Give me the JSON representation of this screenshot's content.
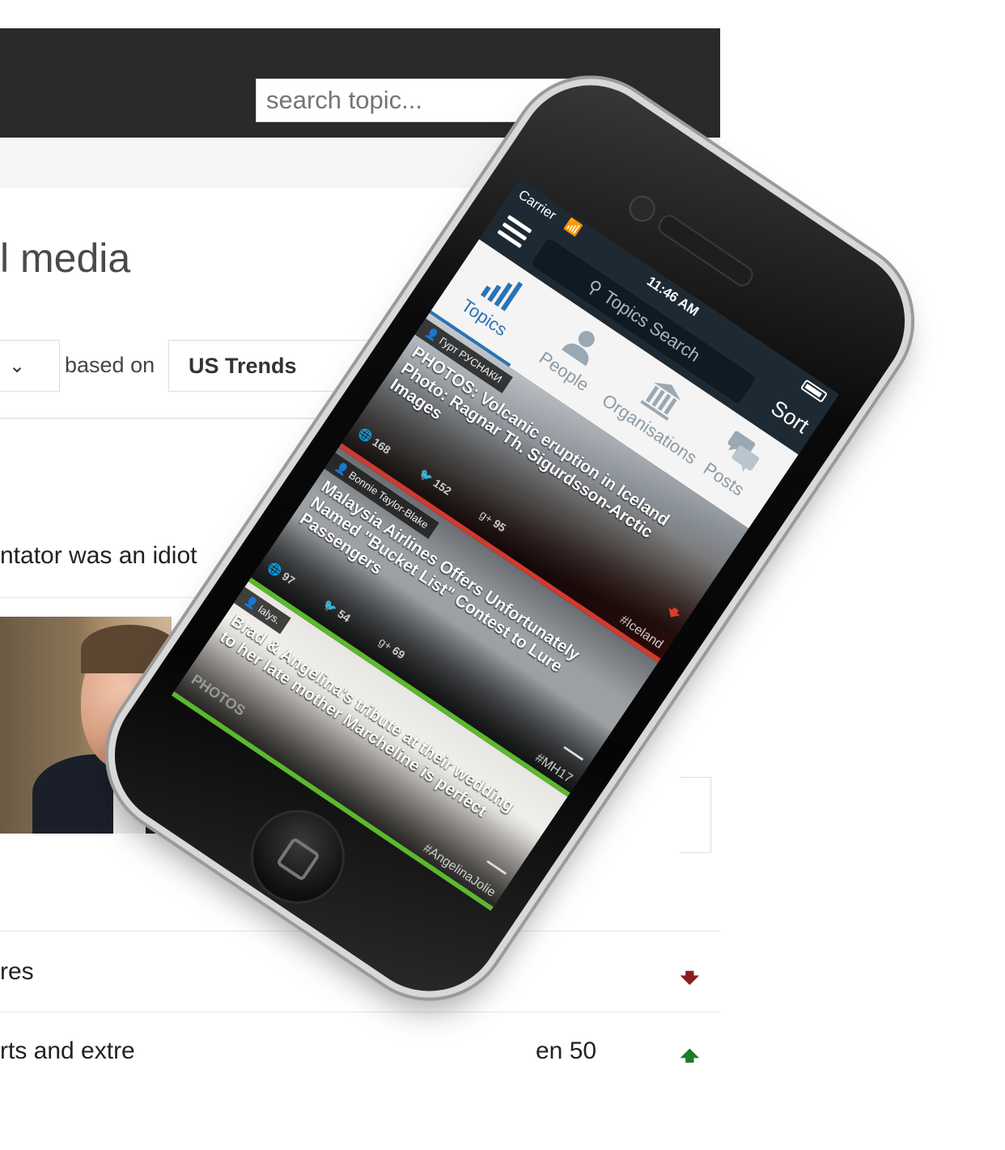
{
  "web": {
    "search_placeholder": "search topic...",
    "title_partial": "l media",
    "based_on": "based on",
    "trend_source": "US Trends",
    "headline_partial": "ntator was an idiot",
    "row1_partial": "res",
    "row2_partial": "rts and extre",
    "row2_tail": "en 50",
    "row1_trend": "down",
    "row2_trend": "up",
    "colors": {
      "topbar": "#2a2a2a",
      "down": "#8a1c1c",
      "up": "#1f7a2a"
    }
  },
  "phone": {
    "status": {
      "carrier": "Carrier",
      "time": "11:46 AM"
    },
    "nav": {
      "search_placeholder": "Topics Search",
      "sort_label": "Sort"
    },
    "tabs": [
      {
        "label": "Topics",
        "icon": "bar-chart-icon",
        "active": true
      },
      {
        "label": "People",
        "icon": "person-icon",
        "active": false
      },
      {
        "label": "Organisations",
        "icon": "building-icon",
        "active": false
      },
      {
        "label": "Posts",
        "icon": "chat-bubbles-icon",
        "active": false
      }
    ],
    "feed": [
      {
        "author": "Гурт РУСНАКИ",
        "title": "PHOTOS: Volcanic eruption in Iceland Photo: Ragnar Th. Sigurdsson-Arctic Images",
        "web_count": "168",
        "twitter_count": "152",
        "gplus_count": "95",
        "tag": "#Iceland",
        "trend": "down",
        "accent": "#d23a2f"
      },
      {
        "author": "Bonnie Taylor-Blake",
        "title": "Malaysia Airlines Offers Unfortunately Named \"Bucket List\" Contest to Lure Passengers",
        "web_count": "97",
        "twitter_count": "54",
        "gplus_count": "69",
        "tag": "#MH17",
        "trend": "flat",
        "accent": "#5cb82c"
      },
      {
        "author": "lalys.",
        "title": "Brad & Angelina's tribute at their wedding to her late mother Marcheline is perfect",
        "overlay_text": "PHOTOS",
        "tag": "#AngelinaJolie",
        "trend": "flat",
        "accent": "#5cb82c"
      }
    ]
  }
}
